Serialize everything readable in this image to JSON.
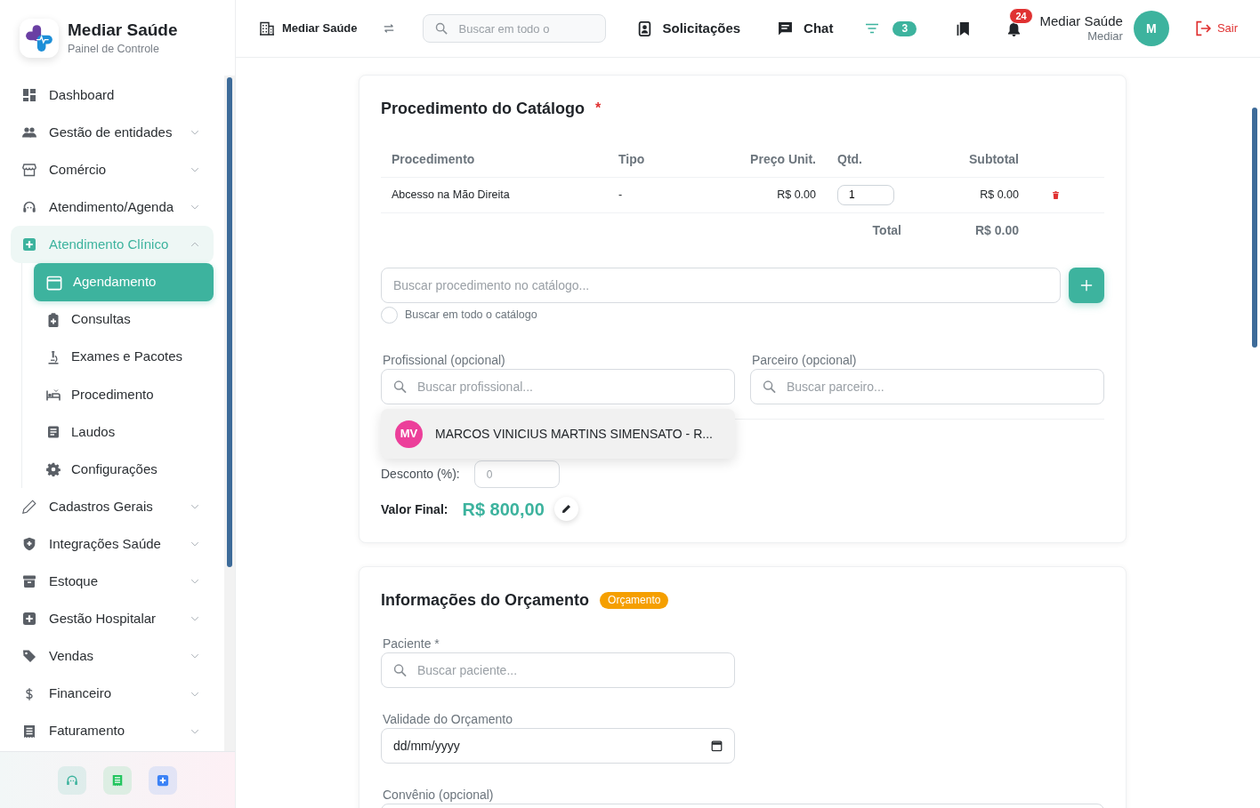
{
  "sidebar": {
    "brand": {
      "title": "Mediar Saúde",
      "subtitle": "Painel de Controle"
    },
    "items": [
      {
        "label": "Dashboard",
        "kind": "link",
        "selected": false
      },
      {
        "label": "Gestão de entidades",
        "kind": "group",
        "expanded": false,
        "selected": false
      },
      {
        "label": "Comércio",
        "kind": "group",
        "expanded": false,
        "selected": false
      },
      {
        "label": "Atendimento/Agenda",
        "kind": "group",
        "expanded": false,
        "selected": false
      },
      {
        "label": "Atendimento Clínico",
        "kind": "group",
        "expanded": true,
        "selected": true,
        "children": [
          {
            "label": "Agendamento",
            "selected": true
          },
          {
            "label": "Consultas",
            "selected": false
          },
          {
            "label": "Exames e Pacotes",
            "selected": false
          },
          {
            "label": "Procedimento",
            "selected": false
          },
          {
            "label": "Laudos",
            "selected": false
          },
          {
            "label": "Configurações",
            "selected": false
          }
        ]
      },
      {
        "label": "Cadastros Gerais",
        "kind": "group",
        "expanded": false,
        "selected": false
      },
      {
        "label": "Integrações Saúde",
        "kind": "group",
        "expanded": false,
        "selected": false
      },
      {
        "label": "Estoque",
        "kind": "group",
        "expanded": false,
        "selected": false
      },
      {
        "label": "Gestão Hospitalar",
        "kind": "group",
        "expanded": false,
        "selected": false
      },
      {
        "label": "Vendas",
        "kind": "group",
        "expanded": false,
        "selected": false
      },
      {
        "label": "Financeiro",
        "kind": "group",
        "expanded": false,
        "selected": false
      },
      {
        "label": "Faturamento",
        "kind": "group",
        "expanded": false,
        "selected": false
      }
    ],
    "footer_buttons": [
      {
        "color": "#3db39e"
      },
      {
        "color": "#22c55e"
      },
      {
        "color": "#3b82f6"
      }
    ]
  },
  "topbar": {
    "organization": "Mediar Saúde",
    "search": {
      "placeholder": "Buscar em todo o"
    },
    "links": [
      {
        "label": "Solicitações"
      },
      {
        "label": "Chat"
      }
    ],
    "filter_count": "3",
    "notification_count": "24",
    "user": {
      "name": "Mediar Saúde",
      "role": "Mediar",
      "initial": "M"
    },
    "logout": "Sair"
  },
  "catalog_card": {
    "title": "Procedimento do Catálogo",
    "required_mark": "*",
    "table": {
      "columns": [
        "Procedimento",
        "Tipo",
        "Preço Unit.",
        "Qtd.",
        "Subtotal"
      ],
      "rows": [
        {
          "procedure": "Abcesso na Mão Direita",
          "type": "-",
          "unit_price": "R$ 0.00",
          "quantity": "1",
          "subtotal": "R$ 0.00"
        }
      ],
      "total_label": "Total",
      "total_value": "R$ 0.00"
    },
    "catalog_search": {
      "placeholder": "Buscar procedimento no catálogo..."
    },
    "search_all": {
      "label": "Buscar em todo o catálogo",
      "checked": false
    },
    "professional": {
      "label": "Profissional (opcional)",
      "placeholder": "Buscar profissional...",
      "suggestions": [
        {
          "initials": "MV",
          "name": "MARCOS VINICIUS MARTINS SIMENSATO - R..."
        }
      ]
    },
    "partner": {
      "label": "Parceiro (opcional)",
      "placeholder": "Buscar parceiro..."
    },
    "discount": {
      "label": "Desconto (%):",
      "placeholder": "0"
    },
    "final_value": {
      "label": "Valor Final:",
      "value": "R$ 800,00"
    }
  },
  "budget_card": {
    "title": "Informações do Orçamento",
    "status_badge": "Orçamento",
    "fields": [
      {
        "kind": "search",
        "label": "Paciente *",
        "placeholder": "Buscar paciente..."
      },
      {
        "kind": "date",
        "label": "Validade do Orçamento",
        "placeholder": "dd/mm/yyyy"
      },
      {
        "kind": "text",
        "label": "Convênio (opcional)"
      }
    ]
  }
}
